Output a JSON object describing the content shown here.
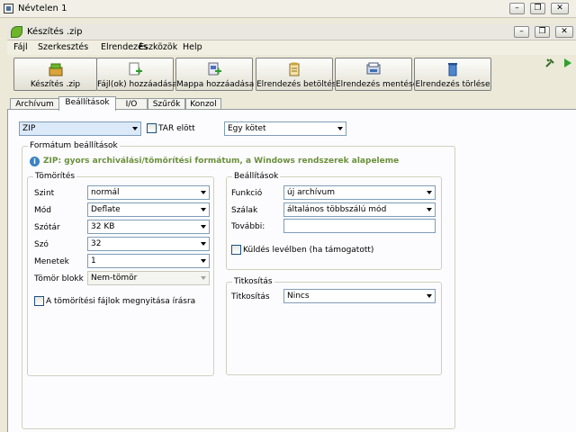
{
  "window": {
    "title": "Névtelen 1"
  },
  "app": {
    "title": "Készítés .zip",
    "accent": "#6fb52c"
  },
  "menu": [
    "Fájl",
    "Szerkesztés",
    "Elrendezés",
    "Eszközök",
    "Help"
  ],
  "toolbar": [
    {
      "label": "Készítés .zip",
      "icon": "archive-create-icon"
    },
    {
      "label": "Fájl(ok) hozzáadása",
      "icon": "add-file-icon"
    },
    {
      "label": "Mappa hozzáadása",
      "icon": "add-folder-icon"
    },
    {
      "label": "Elrendezés betöltése",
      "icon": "load-layout-icon"
    },
    {
      "label": "Elrendezés mentése",
      "icon": "save-layout-icon"
    },
    {
      "label": "Elrendezés törlése",
      "icon": "delete-layout-icon"
    }
  ],
  "tabs": [
    "Archívum",
    "Beállítások",
    "I/O",
    "Szűrők",
    "Konzol"
  ],
  "active_tab": "Beállítások",
  "format": {
    "selected": "ZIP",
    "tar_before_label": "TAR elött",
    "volume": "Egy kötet"
  },
  "format_settings": {
    "title": "Formátum beállítások",
    "info": "ZIP: gyors archiválási/tömörítési formátum, a Windows rendszerek alapeleme"
  },
  "compression": {
    "title": "Tömörítés",
    "rows": [
      {
        "label": "Szint",
        "value": "normál"
      },
      {
        "label": "Mód",
        "value": "Deflate"
      },
      {
        "label": "Szótár",
        "value": "32 KB"
      },
      {
        "label": "Szó",
        "value": "32"
      },
      {
        "label": "Menetek",
        "value": "1"
      },
      {
        "label": "Tömör blokk",
        "value": "Nem-tömör"
      }
    ],
    "open_writable_label": "A tömörítési fájlok megnyitása írásra"
  },
  "settings": {
    "title": "Beállítások",
    "rows": [
      {
        "label": "Funkció",
        "value": "új archívum"
      },
      {
        "label": "Szálak",
        "value": "általános többszálú mód"
      }
    ],
    "more_label": "További:",
    "more_value": "",
    "email_label": "Küldés levélben (ha támogatott)"
  },
  "encryption": {
    "title": "Titkosítás",
    "label": "Titkosítás",
    "value": "Nincs"
  }
}
